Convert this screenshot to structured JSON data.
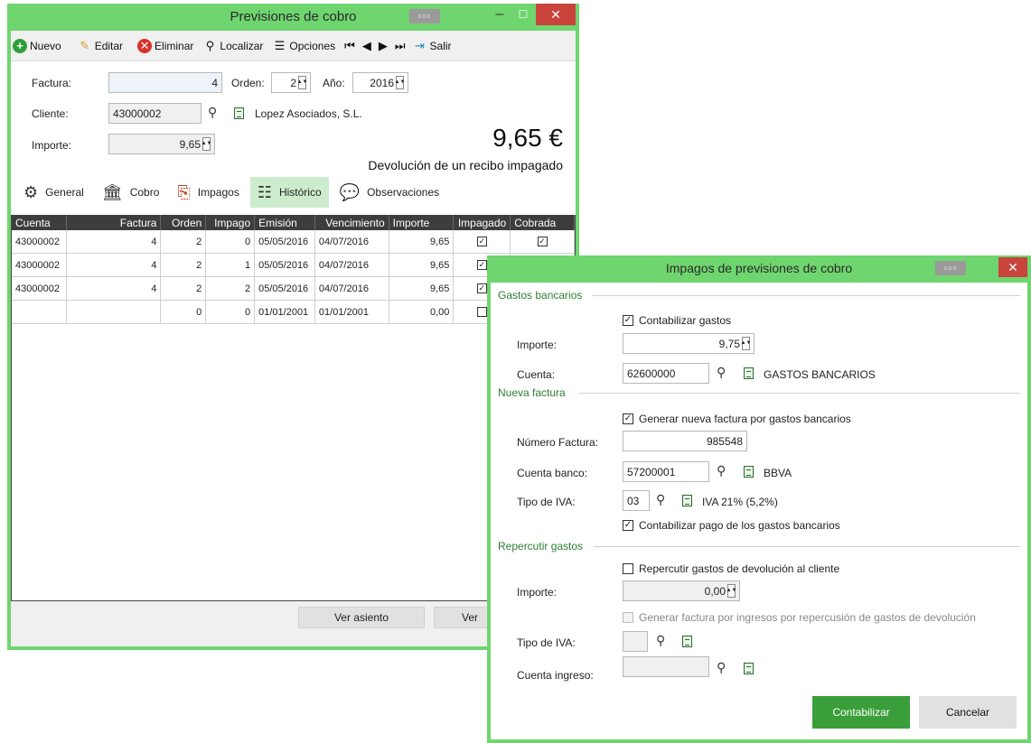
{
  "main_window": {
    "title": "Previsiones de cobro",
    "badge": "ooo",
    "toolbar": {
      "nuevo": "Nuevo",
      "editar": "Editar",
      "eliminar": "Eliminar",
      "localizar": "Localizar",
      "opciones": "Opciones",
      "salir": "Salir"
    },
    "form": {
      "factura_label": "Factura:",
      "factura_value": "4",
      "orden_label": "Orden:",
      "orden_value": "2",
      "anio_label": "Año:",
      "anio_value": "2016",
      "cliente_label": "Cliente:",
      "cliente_value": "43000002",
      "cliente_name": "Lopez Asociados, S.L.",
      "importe_label": "Importe:",
      "importe_value": "9,65",
      "big_amount": "9,65 €",
      "description": "Devolución de un recibo impagado"
    },
    "tabs": [
      {
        "label": "General",
        "icon": "gears-icon"
      },
      {
        "label": "Cobro",
        "icon": "bank-icon"
      },
      {
        "label": "Impagos",
        "icon": "document-arrow-icon"
      },
      {
        "label": "Histórico",
        "icon": "list-icon"
      },
      {
        "label": "Observaciones",
        "icon": "speech-bubble-icon"
      }
    ],
    "grid": {
      "headers": [
        "Cuenta",
        "Factura",
        "Orden",
        "Impago",
        "Emisión",
        "Vencimiento",
        "Importe",
        "Impagado",
        "Cobrada"
      ],
      "rows": [
        {
          "cuenta": "43000002",
          "factura": "4",
          "orden": "2",
          "impago": "0",
          "emision": "05/05/2016",
          "vencimiento": "04/07/2016",
          "importe": "9,65",
          "impagado": true,
          "cobrada": true
        },
        {
          "cuenta": "43000002",
          "factura": "4",
          "orden": "2",
          "impago": "1",
          "emision": "05/05/2016",
          "vencimiento": "04/07/2016",
          "importe": "9,65",
          "impagado": true,
          "cobrada": false
        },
        {
          "cuenta": "43000002",
          "factura": "4",
          "orden": "2",
          "impago": "2",
          "emision": "05/05/2016",
          "vencimiento": "04/07/2016",
          "importe": "9,65",
          "impagado": true,
          "cobrada": false
        },
        {
          "cuenta": "",
          "factura": "",
          "orden": "0",
          "impago": "0",
          "emision": "01/01/2001",
          "vencimiento": "01/01/2001",
          "importe": "0,00",
          "impagado": false,
          "cobrada": false
        }
      ]
    },
    "footer": {
      "ver_asiento": "Ver asiento",
      "ver_truncated": "Ver"
    }
  },
  "dialog": {
    "title": "Impagos de previsiones de cobro",
    "badge": "ooo",
    "gastos_bancarios": {
      "section": "Gastos bancarios",
      "contabilizar_gastos": "Contabilizar gastos",
      "importe_label": "Importe:",
      "importe_value": "9,75",
      "cuenta_label": "Cuenta:",
      "cuenta_value": "62600000",
      "cuenta_name": "GASTOS BANCARIOS"
    },
    "nueva_factura": {
      "section": "Nueva factura",
      "generar": "Generar nueva factura por gastos bancarios",
      "numero_label": "Número Factura:",
      "numero_value": "985548",
      "cuenta_banco_label": "Cuenta banco:",
      "cuenta_banco_value": "57200001",
      "cuenta_banco_name": "BBVA",
      "tipo_iva_label": "Tipo de IVA:",
      "tipo_iva_value": "03",
      "tipo_iva_name": "IVA 21% (5,2%)",
      "contabilizar_pago": "Contabilizar pago de los gastos bancarios"
    },
    "repercutir": {
      "section": "Repercutir gastos",
      "repercutir_cb": "Repercutir gastos de devolución al cliente",
      "importe_label": "Importe:",
      "importe_value": "0,00",
      "generar_factura": "Generar factura por ingresos por repercusión de gastos de devolución",
      "tipo_iva_label": "Tipo de IVA:",
      "cuenta_ingreso_label": "Cuenta ingreso:"
    },
    "buttons": {
      "contabilizar": "Contabilizar",
      "cancelar": "Cancelar"
    }
  },
  "colors": {
    "window_border": "#6fd56f",
    "accent_green": "#3a9e3a",
    "close_red": "#c9443c",
    "section_green": "#2e7d32",
    "grid_header": "#3d3d3d"
  }
}
